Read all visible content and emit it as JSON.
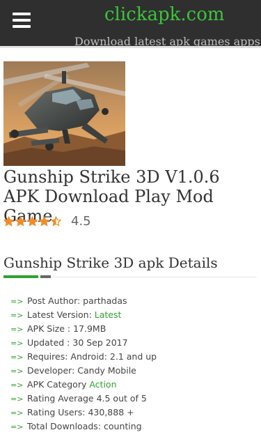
{
  "header": {
    "site_title": "clickapk.com",
    "tagline": "Download latest apk games apps",
    "menu_icon": "hamburger-menu-icon",
    "background_color": "#2f2f2f",
    "title_color": "#3cc43c"
  },
  "post": {
    "image_subject": "helicopter-gunship-image",
    "title": "Gunship Strike 3D V1.0.6 APK Download Play Mod Game",
    "rating": {
      "value": "4.5",
      "stars": 4.5,
      "star_color": "#f28c28"
    }
  },
  "details": {
    "heading": "Gunship Strike 3D apk Details",
    "arrow": "=>",
    "accent_color": "#2ea32e",
    "items": [
      {
        "text": "Post Author: parthadas"
      },
      {
        "text": "Latest Version: ",
        "link": "Latest"
      },
      {
        "text": "APK Size : 17.9MB"
      },
      {
        "text": "Updated : 30 Sep 2017"
      },
      {
        "text": "Requires: Android: 2.1 and up"
      },
      {
        "text": "Developer: Candy Mobile"
      },
      {
        "text": "APK Category ",
        "link": "Action"
      },
      {
        "text": "Rating Average 4.5 out of 5"
      },
      {
        "text": "Rating Users: 430,888 +"
      },
      {
        "text": "Total Downloads: counting"
      }
    ]
  }
}
